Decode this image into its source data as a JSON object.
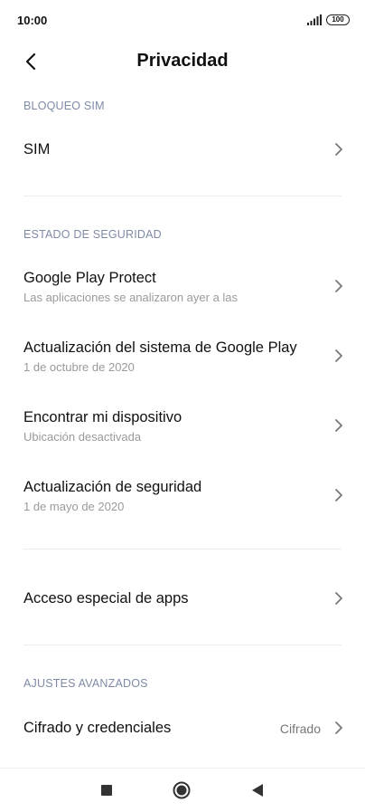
{
  "status": {
    "time": "10:00",
    "battery": "100"
  },
  "header": {
    "title": "Privacidad"
  },
  "sections": {
    "sim_lock": {
      "header": "BLOQUEO SIM",
      "items": [
        {
          "title": "SIM"
        }
      ]
    },
    "security_status": {
      "header": "ESTADO DE SEGURIDAD",
      "items": [
        {
          "title": "Google Play Protect",
          "subtitle": "Las aplicaciones se analizaron ayer a las"
        },
        {
          "title": "Actualización del sistema de Google Play",
          "subtitle": "1 de octubre de 2020"
        },
        {
          "title": "Encontrar mi dispositivo",
          "subtitle": "Ubicación desactivada"
        },
        {
          "title": "Actualización de seguridad",
          "subtitle": "1 de mayo de 2020"
        }
      ]
    },
    "special": {
      "items": [
        {
          "title": "Acceso especial de apps"
        }
      ]
    },
    "advanced": {
      "header": "AJUSTES AVANZADOS",
      "items": [
        {
          "title": "Cifrado y credenciales",
          "value": "Cifrado"
        }
      ]
    }
  },
  "colors": {
    "section_header": "#7f8aa6",
    "subtitle": "#9a9a9a",
    "divider": "#ececec"
  },
  "icons": [
    "signal-icon",
    "battery-icon",
    "back-arrow-icon",
    "chevron-right-icon",
    "nav-recents-icon",
    "nav-home-icon",
    "nav-back-icon"
  ]
}
